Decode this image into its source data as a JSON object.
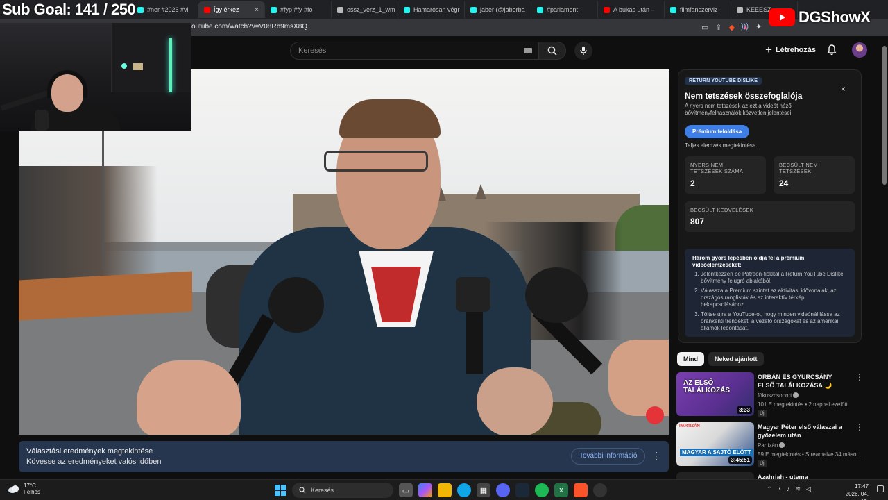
{
  "stream": {
    "subgoal": "Sub Goal:  141 / 250",
    "brand": "DGShowX"
  },
  "browser": {
    "tabs": [
      {
        "label": "#ner #2026 #vi",
        "color": "#25f4ee"
      },
      {
        "label": "Így érkez",
        "color": "#ff0000",
        "active": true
      },
      {
        "label": "#fyp #fy #fo",
        "color": "#25f4ee"
      },
      {
        "label": "ossz_verz_1_wm",
        "color": "#bbbbbb"
      },
      {
        "label": "Hamarosan végr",
        "color": "#25f4ee"
      },
      {
        "label": "jaber (@jaberba",
        "color": "#25f4ee"
      },
      {
        "label": "#parlament",
        "color": "#25f4ee"
      },
      {
        "label": "A bukás után –",
        "color": "#ff0000"
      },
      {
        "label": "filmfanszerviz",
        "color": "#25f4ee"
      },
      {
        "label": "KEEESZ.png",
        "color": "#bbbbbb"
      }
    ],
    "url": "outube.com/watch?v=V08Rb9msX8Q"
  },
  "youtube": {
    "search_placeholder": "Keresés",
    "create_label": "Létrehozás",
    "banner": {
      "title": "Választási eredmények megtekintése",
      "subtitle": "Kövesse az eredményeket valós időben",
      "more_label": "További információ"
    },
    "chips": [
      "Mind",
      "Neked ajánlott"
    ],
    "recommendations": [
      {
        "title": "ORBÁN ÉS GYURCSÁNY ELSŐ TALÁLKOZÁSA 🌙",
        "channel": "fókuszcsoport",
        "meta": "101 E megtekintés • 2 nappal ezelőtt",
        "badge": "Új",
        "duration": "3:33",
        "thumb_text": "AZ ELSŐ TALÁLKOZÁS"
      },
      {
        "title": "Magyar Péter első válaszai a győzelem után",
        "channel": "Partizán",
        "meta": "59 E megtekintés • Streamelve 34 máso...",
        "badge": "Új",
        "duration": "3:45:51",
        "thumb_text": "MAGYAR A SAJTÓ ELŐTT",
        "thumb_brand": "PARTIZÁN"
      },
      {
        "title": "Azahriah - utema",
        "channel": "",
        "meta": "",
        "badge": "",
        "duration": ""
      }
    ]
  },
  "ryd": {
    "badge": "RETURN YOUTUBE DISLIKE",
    "title": "Nem tetszések összefoglalója",
    "description": "A nyers nem tetszések az ezt a videót néző bővítményfelhasználók közvetlen jelentései.",
    "premium_button": "Prémium feloldása",
    "full_analysis": "Teljes elemzés megtekintése",
    "raw_dislikes_label": "NYERS NEM TETSZÉSEK SZÁMA",
    "raw_dislikes": "2",
    "est_dislikes_label": "BECSÜLT NEM TETSZÉSEK",
    "est_dislikes": "24",
    "est_likes_label": "BECSÜLT KEDVELÉSEK",
    "est_likes": "807",
    "promo_title": "Három gyors lépésben oldja fel a prémium videóelemzéseket:",
    "promo_steps": [
      "Jelentkezzen be Patreon-fiókkal a Return YouTube Dislike bővítmény felugró ablakából.",
      "Válassza a Premium szintet az aktivitási idővonalak, az országos ranglisták és az interaktív térkép bekapcsolásához.",
      "Töltse újra a YouTube-ot, hogy minden videónál lássa az óránkénti trendeket, a vezető országokat és az amerikai államok lebontását."
    ]
  },
  "taskbar": {
    "weather_temp": "17°C",
    "weather_desc": "Felhős",
    "search_label": "Keresés",
    "time": "17:47",
    "date": "2026. 04. 13."
  }
}
